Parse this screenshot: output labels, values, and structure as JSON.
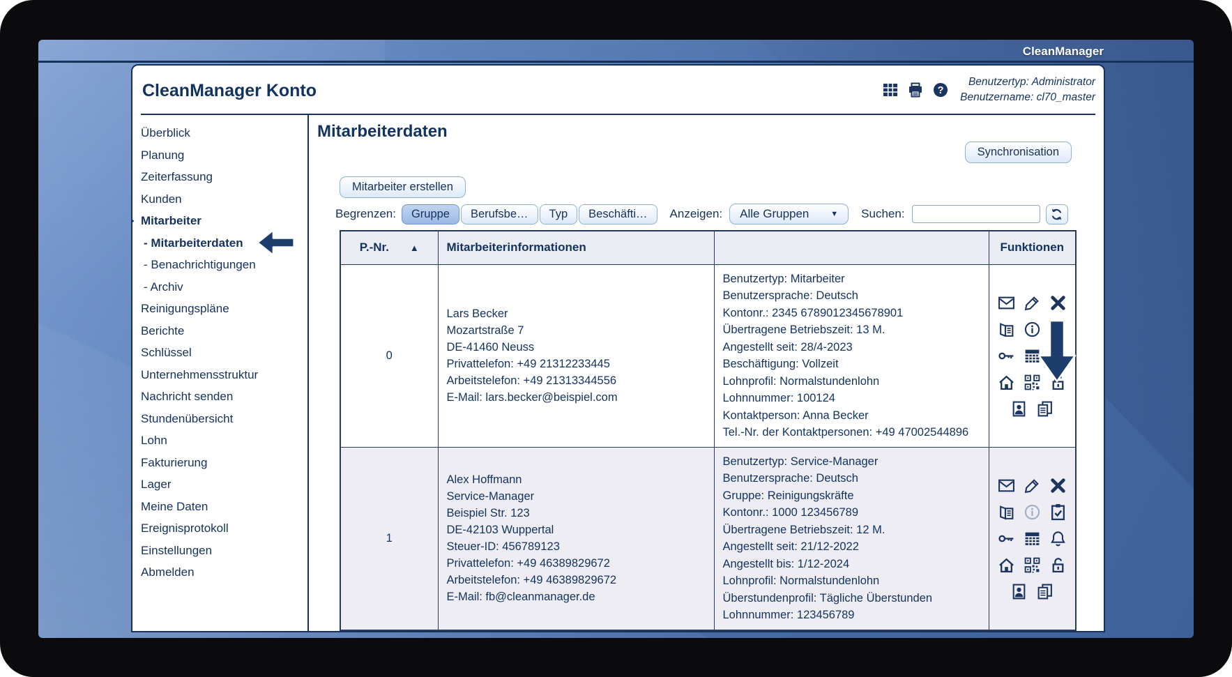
{
  "brand": "CleanManager",
  "window": {
    "title": "CleanManager Konto",
    "user_type": "Benutzertyp: Administrator",
    "user_name": "Benutzername: cl70_master",
    "header_icons": [
      "table-grid",
      "printer",
      "help"
    ]
  },
  "sidebar": {
    "items": [
      {
        "label": "Überblick"
      },
      {
        "label": "Planung"
      },
      {
        "label": "Zeiterfassung"
      },
      {
        "label": "Kunden"
      },
      {
        "label": "Mitarbeiter",
        "bold": true,
        "pointer": "right-arrow"
      },
      {
        "label": "- Mitarbeiterdaten",
        "bold": true,
        "sub": true,
        "pointer": "left-arrow"
      },
      {
        "label": "- Benachrichtigungen",
        "sub": true
      },
      {
        "label": "- Archiv",
        "sub": true
      },
      {
        "label": "Reinigungspläne"
      },
      {
        "label": "Berichte"
      },
      {
        "label": "Schlüssel"
      },
      {
        "label": "Unternehmensstruktur"
      },
      {
        "label": "Nachricht senden"
      },
      {
        "label": "Stundenübersicht"
      },
      {
        "label": "Lohn"
      },
      {
        "label": "Fakturierung"
      },
      {
        "label": "Lager"
      },
      {
        "label": "Meine Daten"
      },
      {
        "label": "Ereignisprotokoll"
      },
      {
        "label": "Einstellungen"
      },
      {
        "label": "Abmelden"
      }
    ]
  },
  "main": {
    "heading": "Mitarbeiterdaten",
    "sync_button": "Synchronisation",
    "create_button": "Mitarbeiter erstellen",
    "filters": {
      "limit_label": "Begrenzen:",
      "limit_buttons": [
        {
          "label": "Gruppe",
          "selected": true
        },
        {
          "label": "Berufsbe…",
          "selected": false
        },
        {
          "label": "Typ",
          "selected": false
        },
        {
          "label": "Beschäfti…",
          "selected": false
        }
      ],
      "show_label": "Anzeigen:",
      "group_dropdown": "Alle Gruppen",
      "search_label": "Suchen:",
      "search_value": ""
    },
    "table": {
      "headers": {
        "pnr": "P.-Nr.",
        "info": "Mitarbeiterinformationen",
        "details": "",
        "functions": "Funktionen"
      },
      "sort_icon": "sort-ascending",
      "rows": [
        {
          "pnr": "0",
          "info_lines": [
            "Lars Becker",
            "Mozartstraße 7",
            "DE-41460 Neuss",
            "Privattelefon: +49 21312233445",
            "Arbeitstelefon: +49 21313344556",
            "E-Mail: lars.becker@beispiel.com"
          ],
          "detail_lines": [
            "Benutzertyp: Mitarbeiter",
            "Benutzersprache: Deutsch",
            "Kontonr.: 2345 6789012345678901",
            "Übertragene Betriebszeit: 13 M.",
            "Angestellt seit: 28/4-2023",
            "Beschäftigung: Vollzeit",
            "Lohnprofil: Normalstundenlohn",
            "Lohnnummer: 100124",
            "Kontaktperson: Anna Becker",
            "Tel.-Nr. der Kontaktpersonen: +49 47002544896"
          ],
          "icon_rows": [
            [
              "envelope",
              "pencil",
              "close"
            ],
            [
              "ledger",
              "info",
              "clipboard-check"
            ],
            [
              "key",
              "calendar",
              "spacer"
            ],
            [
              "house",
              "qr-code",
              "lock-open"
            ],
            [
              "portrait",
              "documents"
            ]
          ],
          "arrow_annotation": true
        },
        {
          "pnr": "1",
          "info_lines": [
            "Alex Hoffmann",
            "Service-Manager",
            "Beispiel Str. 123",
            "DE-42103 Wuppertal",
            "Steuer-ID: 456789123",
            "Privattelefon: +49 46389829672",
            "Arbeitstelefon: +49 46389829672",
            "E-Mail: fb@cleanmanager.de"
          ],
          "detail_lines": [
            "Benutzertyp: Service-Manager",
            "Benutzersprache: Deutsch",
            "Gruppe: Reinigungskräfte",
            "Kontonr.: 1000 123456789",
            "Übertragene Betriebszeit: 12 M.",
            "Angestellt seit: 21/12-2022",
            "Angestellt bis: 1/12-2024",
            "Lohnprofil: Normalstundenlohn",
            "Überstundenprofil: Tägliche Überstunden",
            "Lohnnummer: 123456789"
          ],
          "icon_rows": [
            [
              "envelope",
              "pencil",
              "close"
            ],
            [
              "ledger",
              "info-disabled",
              "clipboard-check"
            ],
            [
              "key",
              "calendar",
              "bell"
            ],
            [
              "house",
              "qr-code",
              "lock-open"
            ],
            [
              "portrait",
              "documents"
            ]
          ],
          "arrow_annotation": false
        }
      ]
    }
  },
  "colors": {
    "accent": "#1d3e6d",
    "selected_filter": "#9bb9e5",
    "row_alt": "#ededf3",
    "navy_text": "#16315c"
  }
}
